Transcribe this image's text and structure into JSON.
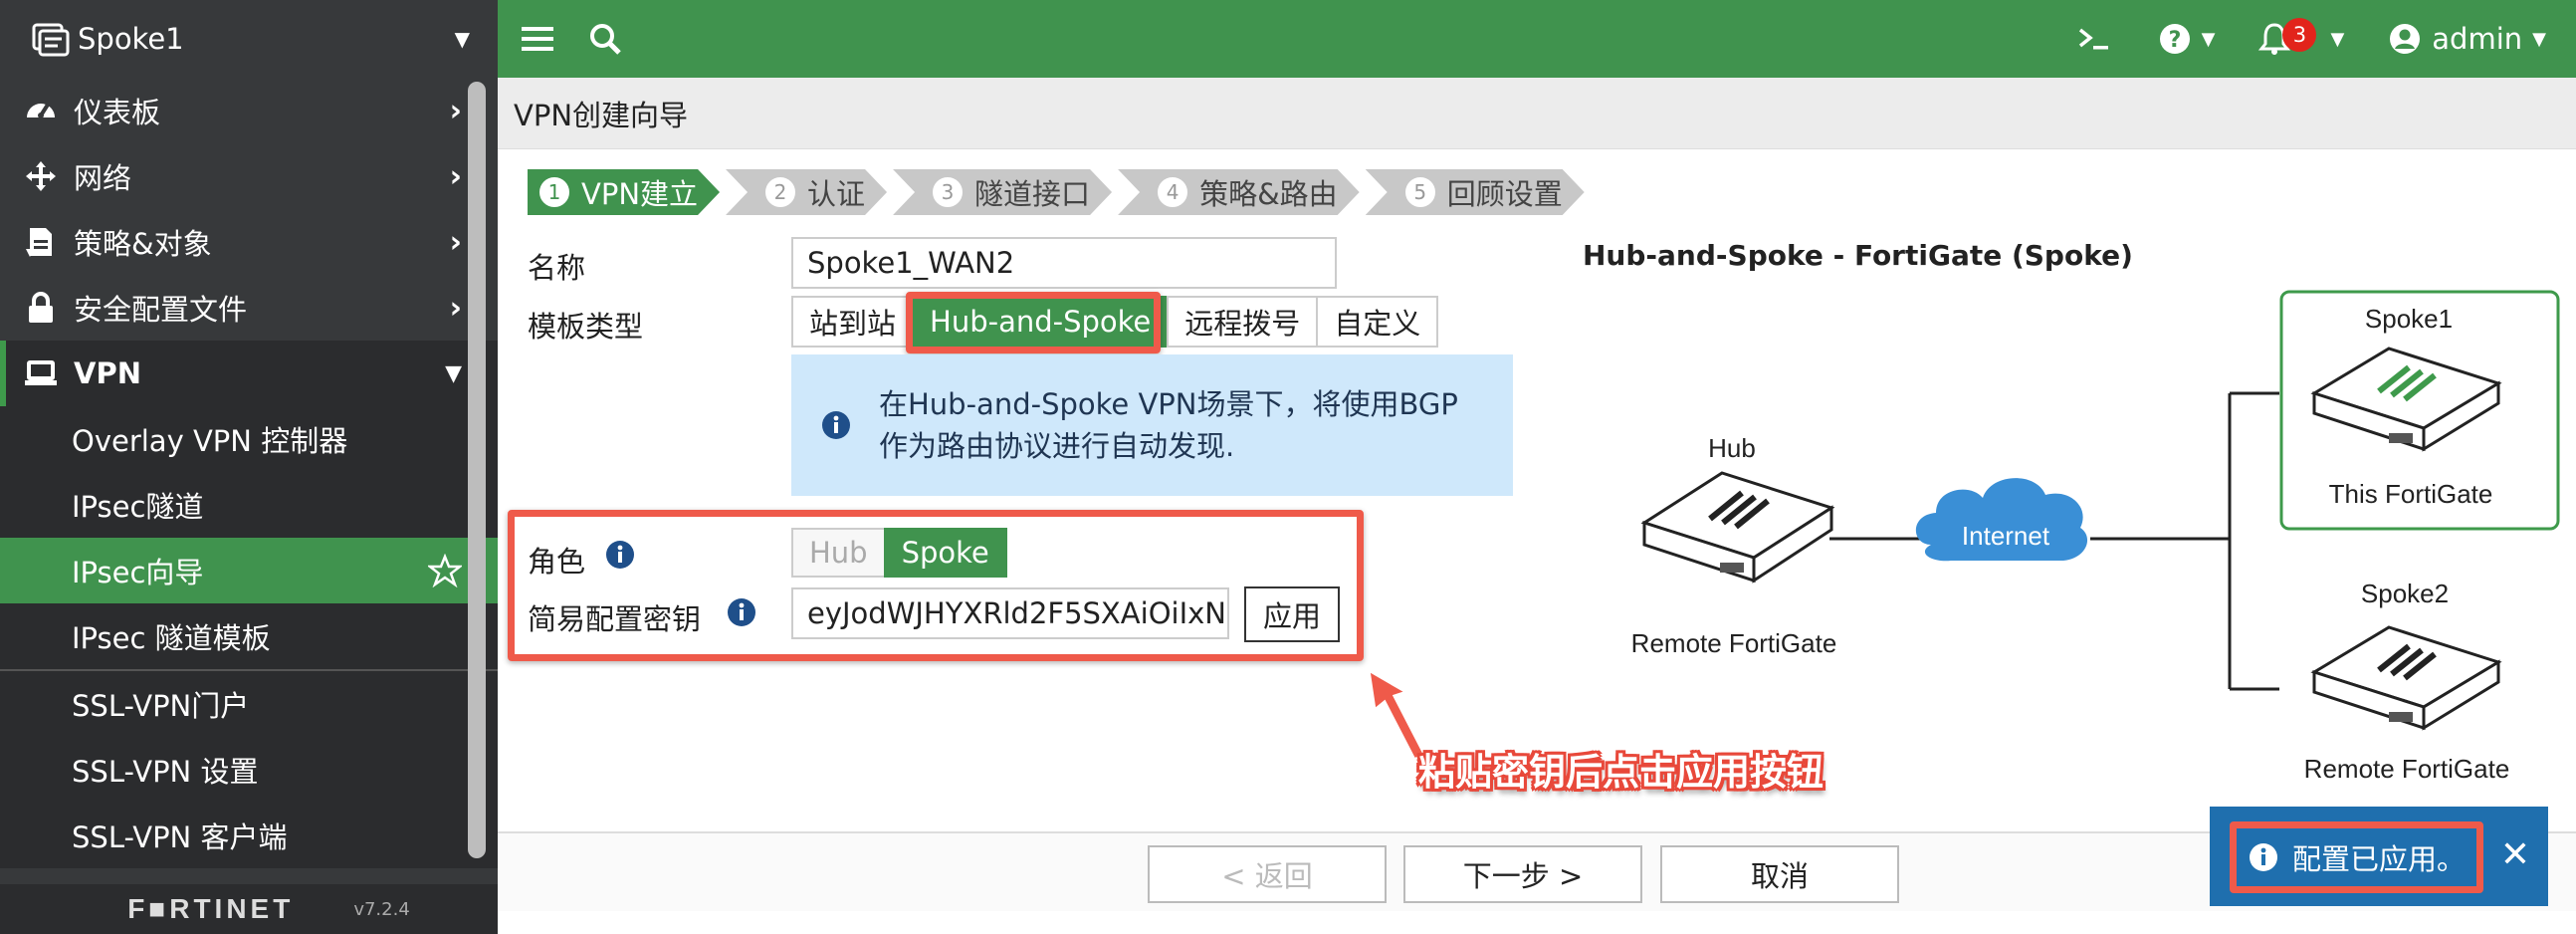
{
  "sidebar": {
    "device_name": "Spoke1",
    "items": [
      {
        "label": "仪表板"
      },
      {
        "label": "网络"
      },
      {
        "label": "策略&对象"
      },
      {
        "label": "安全配置文件"
      },
      {
        "label": "VPN"
      }
    ],
    "vpn_sub": [
      {
        "label": "Overlay VPN 控制器"
      },
      {
        "label": "IPsec隧道"
      },
      {
        "label": "IPsec向导"
      },
      {
        "label": "IPsec 隧道模板"
      },
      {
        "label": "SSL-VPN门户"
      },
      {
        "label": "SSL-VPN 设置"
      },
      {
        "label": "SSL-VPN 客户端"
      }
    ],
    "footer_logo": "F■RTINET",
    "version": "v7.2.4"
  },
  "topbar": {
    "notification_count": "3",
    "user": "admin"
  },
  "page": {
    "title": "VPN创建向导"
  },
  "steps": [
    {
      "num": "1",
      "label": "VPN建立"
    },
    {
      "num": "2",
      "label": "认证"
    },
    {
      "num": "3",
      "label": "隧道接口"
    },
    {
      "num": "4",
      "label": "策略&路由"
    },
    {
      "num": "5",
      "label": "回顾设置"
    }
  ],
  "form": {
    "name_label": "名称",
    "name_value": "Spoke1_WAN2",
    "template_label": "模板类型",
    "template_options": [
      "站到站",
      "Hub-and-Spoke",
      "远程拨号",
      "自定义"
    ],
    "info_text_line1": "在Hub-and-Spoke VPN场景下，将使用BGP",
    "info_text_line2": "作为路由协议进行自动发现.",
    "role_label": "角色",
    "role_options": [
      "Hub",
      "Spoke"
    ],
    "key_label": "简易配置密钥",
    "key_value": "eyJodWJHYXRld2F5SXAiOiIxN",
    "apply_label": "应用"
  },
  "callout": "粘贴密钥后点击应用按钮",
  "buttons": {
    "back": "< 返回",
    "next": "下一步 >",
    "cancel": "取消"
  },
  "toast": {
    "message": "配置已应用。"
  },
  "diagram": {
    "title": "Hub-and-Spoke - FortiGate (Spoke)",
    "hub_label": "Hub",
    "hub_caption": "Remote FortiGate",
    "cloud_label": "Internet",
    "spoke1_label": "Spoke1",
    "spoke1_caption": "This FortiGate",
    "spoke2_label": "Spoke2",
    "spoke2_caption": "Remote FortiGate"
  },
  "colors": {
    "brand_green": "#40934e",
    "highlight_red": "#ef5a4a",
    "info_blue": "#cfe8fb",
    "toast_blue": "#1f6fae"
  }
}
